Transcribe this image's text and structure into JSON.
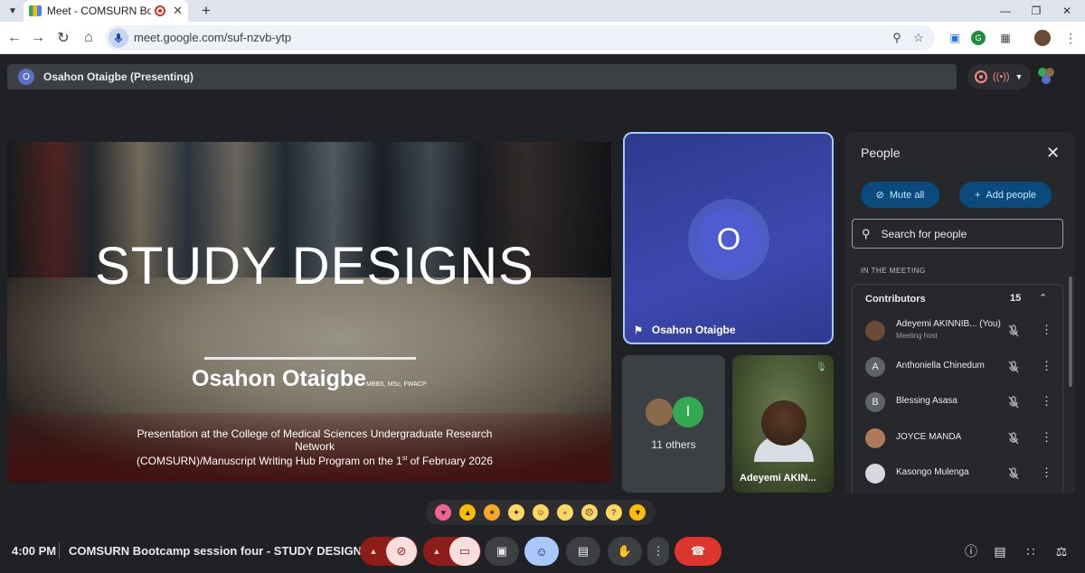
{
  "browser": {
    "tab": {
      "title": "Meet - COMSURN Bootcam"
    },
    "address": {
      "url": "meet.google.com/suf-nzvb-ytp"
    },
    "icons": {
      "tab_menu": "chevron-down-icon",
      "new_tab": "plus-icon",
      "minimize": "minimize-icon",
      "maximize": "maximize-icon",
      "close": "close-icon",
      "back": "arrow-left-icon",
      "forward": "arrow-right-icon",
      "reload": "reload-icon",
      "home": "home-icon",
      "zoom": "zoom-out-icon",
      "bookmark": "star-icon",
      "extensions": "puzzle-icon",
      "menu": "kebab-menu-icon"
    }
  },
  "meet": {
    "presenting_bar": {
      "avatar_letter": "O",
      "label": "Osahon Otaigbe (Presenting)"
    },
    "slide": {
      "title": "STUDY DESIGNS",
      "author": "Osahon Otaigbe",
      "credentials": "MBBS, MSc, FWACP",
      "description_line1": "Presentation at the College of Medical Sciences Undergraduate Research Network",
      "description_line2_pre": "(COMSURN)/Manuscript Writing Hub Program on the 1",
      "description_line2_sup": "st",
      "description_line2_post": " of February 2026"
    },
    "presenter_tile": {
      "avatar_letter": "O",
      "name": "Osahon Otaigbe"
    },
    "others_tile": {
      "avatar_letter": "I",
      "label": "11 others"
    },
    "video_tile": {
      "name": "Adeyemi AKIN..."
    },
    "people_panel": {
      "title": "People",
      "mute_all": "Mute all",
      "add_people": "Add people",
      "search_placeholder": "Search for people",
      "section_label": "IN THE MEETING",
      "contributors_label": "Contributors",
      "contributors_count": "15",
      "people": [
        {
          "name": "Adeyemi AKINNIB... (You)",
          "sub": "Meeting host",
          "initial": "",
          "avatar_color": "#6b4a36"
        },
        {
          "name": "Anthoniella Chinedum",
          "sub": "",
          "initial": "A",
          "avatar_color": "#5f6368"
        },
        {
          "name": "Blessing Asasa",
          "sub": "",
          "initial": "B",
          "avatar_color": "#5f6368"
        },
        {
          "name": "JOYCE MANDA",
          "sub": "",
          "initial": "",
          "avatar_color": "#b07a5a"
        },
        {
          "name": "Kasongo Mulenga",
          "sub": "",
          "initial": "",
          "avatar_color": "#d5d8e0"
        }
      ]
    },
    "reactions": [
      "sparkling-heart",
      "thumbs-up",
      "party-popper",
      "clapping-hands",
      "tears-of-joy",
      "surprised-face",
      "crying-face",
      "thinking-face",
      "thumbs-down"
    ],
    "bottom_bar": {
      "time": "4:00 PM",
      "meeting_title": "COMSURN Bootcamp session four - STUDY DESIGN..."
    },
    "colors": {
      "accent_blue": "#a8c7fa",
      "end_call_red": "#dc362e",
      "presenter_tile": "#3d49b0"
    }
  }
}
